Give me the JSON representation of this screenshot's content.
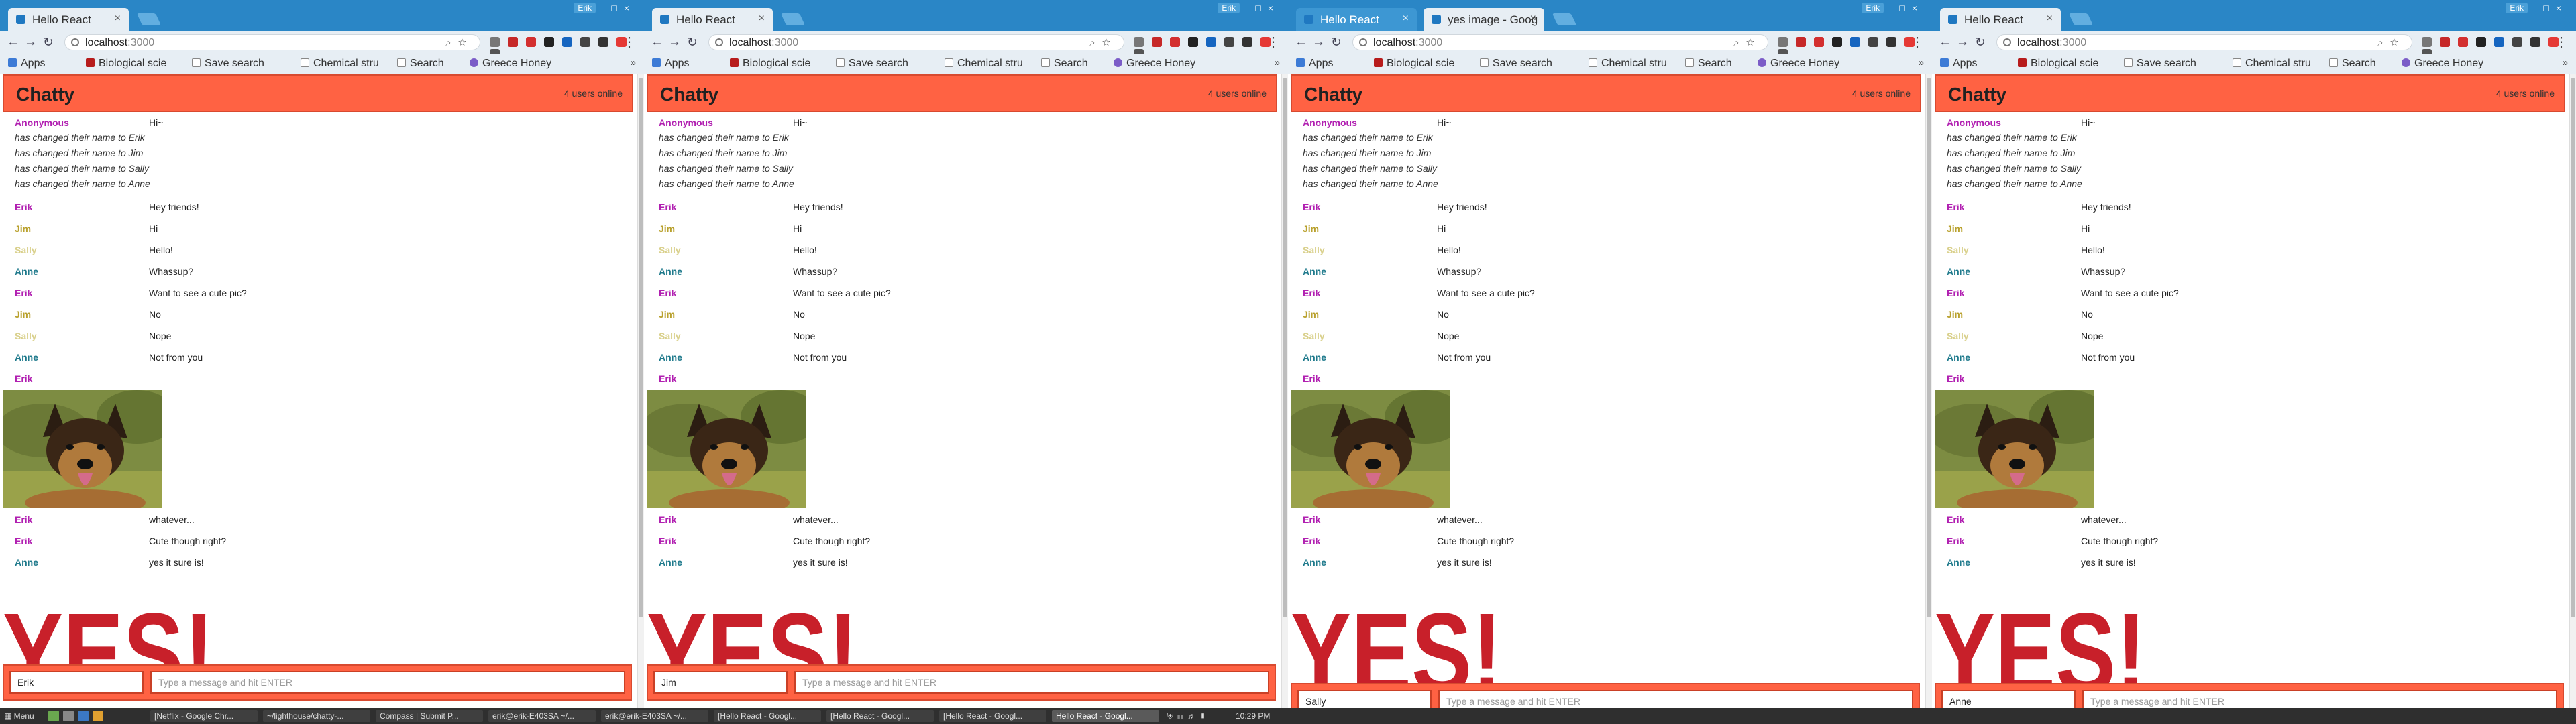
{
  "browser": {
    "url_host": "localhost",
    "url_port": ":3000",
    "profile_badge": "Erik",
    "bookmarks": [
      "Apps",
      "Biological scie",
      "Save search",
      "Chemical stru",
      "Search",
      "Greece Honey"
    ]
  },
  "windows": [
    {
      "tabs": [
        {
          "title": "Hello React"
        }
      ],
      "username": "Erik",
      "bottom_bar": "low",
      "focused": false
    },
    {
      "tabs": [
        {
          "title": "Hello React"
        }
      ],
      "username": "Jim",
      "bottom_bar": "low",
      "focused": false
    },
    {
      "tabs": [
        {
          "title": "Hello React"
        },
        {
          "title": "yes image - Goog"
        }
      ],
      "username": "Sally",
      "bottom_bar": "high",
      "focused": true
    },
    {
      "tabs": [
        {
          "title": "Hello React"
        }
      ],
      "username": "Anne",
      "bottom_bar": "high",
      "focused": false
    }
  ],
  "chat": {
    "title": "Chatty",
    "online": "4 users online",
    "placeholder": "Type a message and hit ENTER",
    "messages": [
      {
        "type": "message",
        "user": "Anonymous",
        "text": "Hi~",
        "color": "#b11fb1"
      },
      {
        "type": "system",
        "text": "has changed their name to Erik"
      },
      {
        "type": "system",
        "text": "has changed their name to Jim"
      },
      {
        "type": "system",
        "text": "has changed their name to Sally"
      },
      {
        "type": "system",
        "text": "has changed their name to Anne"
      },
      {
        "type": "message",
        "user": "Erik",
        "text": "Hey friends!",
        "color": "#b11fb1"
      },
      {
        "type": "message",
        "user": "Jim",
        "text": "Hi",
        "color": "#b9a12e"
      },
      {
        "type": "message",
        "user": "Sally",
        "text": "Hello!",
        "color": "#d9d08b"
      },
      {
        "type": "message",
        "user": "Anne",
        "text": "Whassup?",
        "color": "#1f7a8c"
      },
      {
        "type": "message",
        "user": "Erik",
        "text": "Want to see a cute pic?",
        "color": "#b11fb1"
      },
      {
        "type": "message",
        "user": "Jim",
        "text": "No",
        "color": "#b9a12e"
      },
      {
        "type": "message",
        "user": "Sally",
        "text": "Nope",
        "color": "#d9d08b"
      },
      {
        "type": "message",
        "user": "Anne",
        "text": "Not from you",
        "color": "#1f7a8c"
      },
      {
        "type": "message",
        "user": "Erik",
        "text": "",
        "color": "#b11fb1"
      },
      {
        "type": "image",
        "image": "german-shepherd-dog-photo"
      },
      {
        "type": "message",
        "user": "Erik",
        "text": "whatever...",
        "color": "#b11fb1"
      },
      {
        "type": "message",
        "user": "Erik",
        "text": "Cute though right?",
        "color": "#b11fb1"
      },
      {
        "type": "message",
        "user": "Anne",
        "text": "yes it sure is!",
        "color": "#1f7a8c"
      },
      {
        "type": "image",
        "image": "yes-red-text-image",
        "text": "YES!"
      }
    ]
  },
  "taskbar": {
    "menu": "Menu",
    "items": [
      {
        "label": "[Netflix - Google Chr...",
        "active": false
      },
      {
        "label": "~/lighthouse/chatty-...",
        "active": false
      },
      {
        "label": "Compass | Submit P...",
        "active": false
      },
      {
        "label": "erik@erik-E403SA ~/...",
        "active": false
      },
      {
        "label": "erik@erik-E403SA ~/...",
        "active": false
      },
      {
        "label": "[Hello React - Googl...",
        "active": false
      },
      {
        "label": "[Hello React - Googl...",
        "active": false
      },
      {
        "label": "[Hello React - Googl...",
        "active": false
      },
      {
        "label": "Hello React - Googl...",
        "active": true
      }
    ],
    "clock": "10:29 PM"
  }
}
